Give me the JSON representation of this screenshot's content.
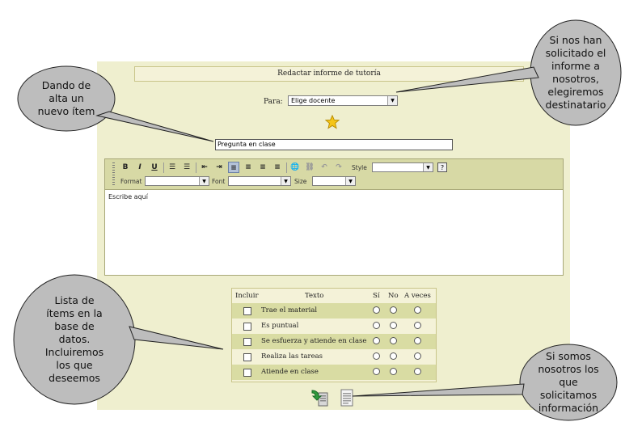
{
  "form": {
    "title": "Redactar informe de tutoría",
    "para_label": "Para:",
    "recipient_value": "Elige docente",
    "item_value": "Pregunta en clase"
  },
  "editor": {
    "style_label": "Style",
    "format_label": "Format",
    "font_label": "Font",
    "size_label": "Size",
    "content": "Escribe aquí",
    "help_label": "?",
    "bold_label": "B",
    "italic_label": "I",
    "underline_label": "U"
  },
  "table": {
    "headers": {
      "include": "Incluir",
      "text": "Texto",
      "yes": "Sí",
      "no": "No",
      "sometimes": "A veces"
    },
    "rows": [
      {
        "text": "Trae el material"
      },
      {
        "text": "Es puntual"
      },
      {
        "text": "Se esfuerza y atiende en clase"
      },
      {
        "text": "Realiza las tareas"
      },
      {
        "text": "Atiende en clase"
      }
    ]
  },
  "callouts": {
    "add_item": "Dando de\nalta un\nnuevo ítem",
    "recipient": "Si nos han\nsolicitado el\ninforme a\nnosotros,\nelegiremos\ndestinatario",
    "item_list": "Lista de\nítems en la\nbase de\ndatos.\nIncluiremos\nlos que\ndeseemos",
    "request": "Si somos\nnosotros los\nque\nsolicitamos\ninformación"
  },
  "colors": {
    "panel_bg": "#efefcf",
    "toolbar_bg": "#d7d9a5",
    "row_highlight": "#d9dca3",
    "bubble_fill": "#bdbdbd"
  },
  "icons": [
    "star-icon",
    "send-report-icon",
    "request-document-icon",
    "bold-icon",
    "italic-icon",
    "underline-icon"
  ]
}
